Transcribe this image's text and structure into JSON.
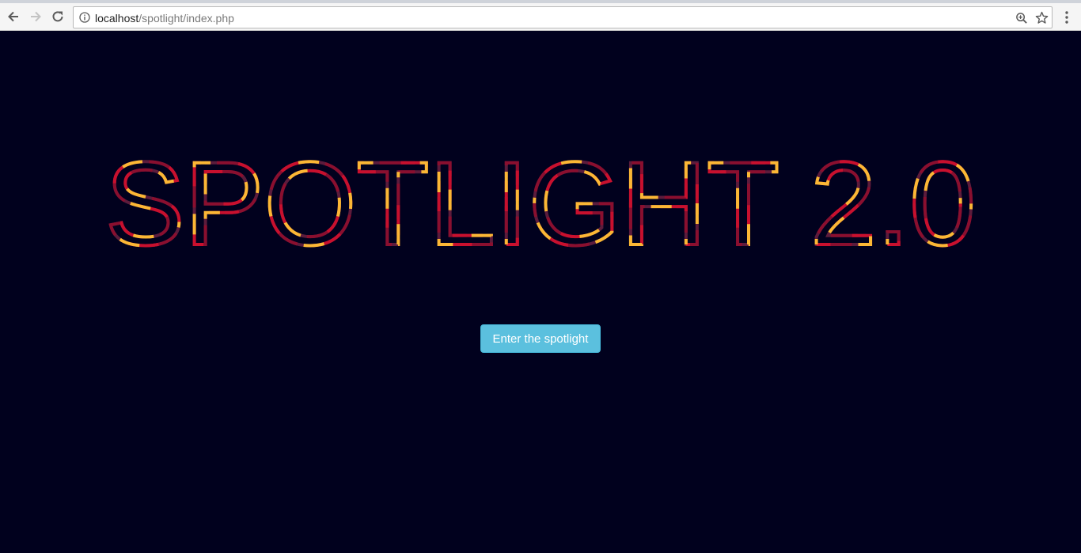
{
  "browser": {
    "url_host": "localhost",
    "url_path": "/spotlight/index.php",
    "icons": {
      "back": "back-arrow-icon",
      "forward": "forward-arrow-icon",
      "reload": "reload-icon",
      "info": "info-icon",
      "zoom": "zoom-icon",
      "bookmark": "star-icon",
      "menu": "kebab-menu-icon"
    }
  },
  "page": {
    "title": "SPOTLIGHT 2.0",
    "cta_label": "Enter the spotlight"
  },
  "colors": {
    "background": "#01011e",
    "stroke_red": "#c8102e",
    "stroke_yellow": "#fbb735",
    "stroke_plum": "#5c1c3c",
    "stroke_dark_red": "#8a0f2f",
    "button_bg": "#5bc0de",
    "button_text": "#ffffff"
  }
}
